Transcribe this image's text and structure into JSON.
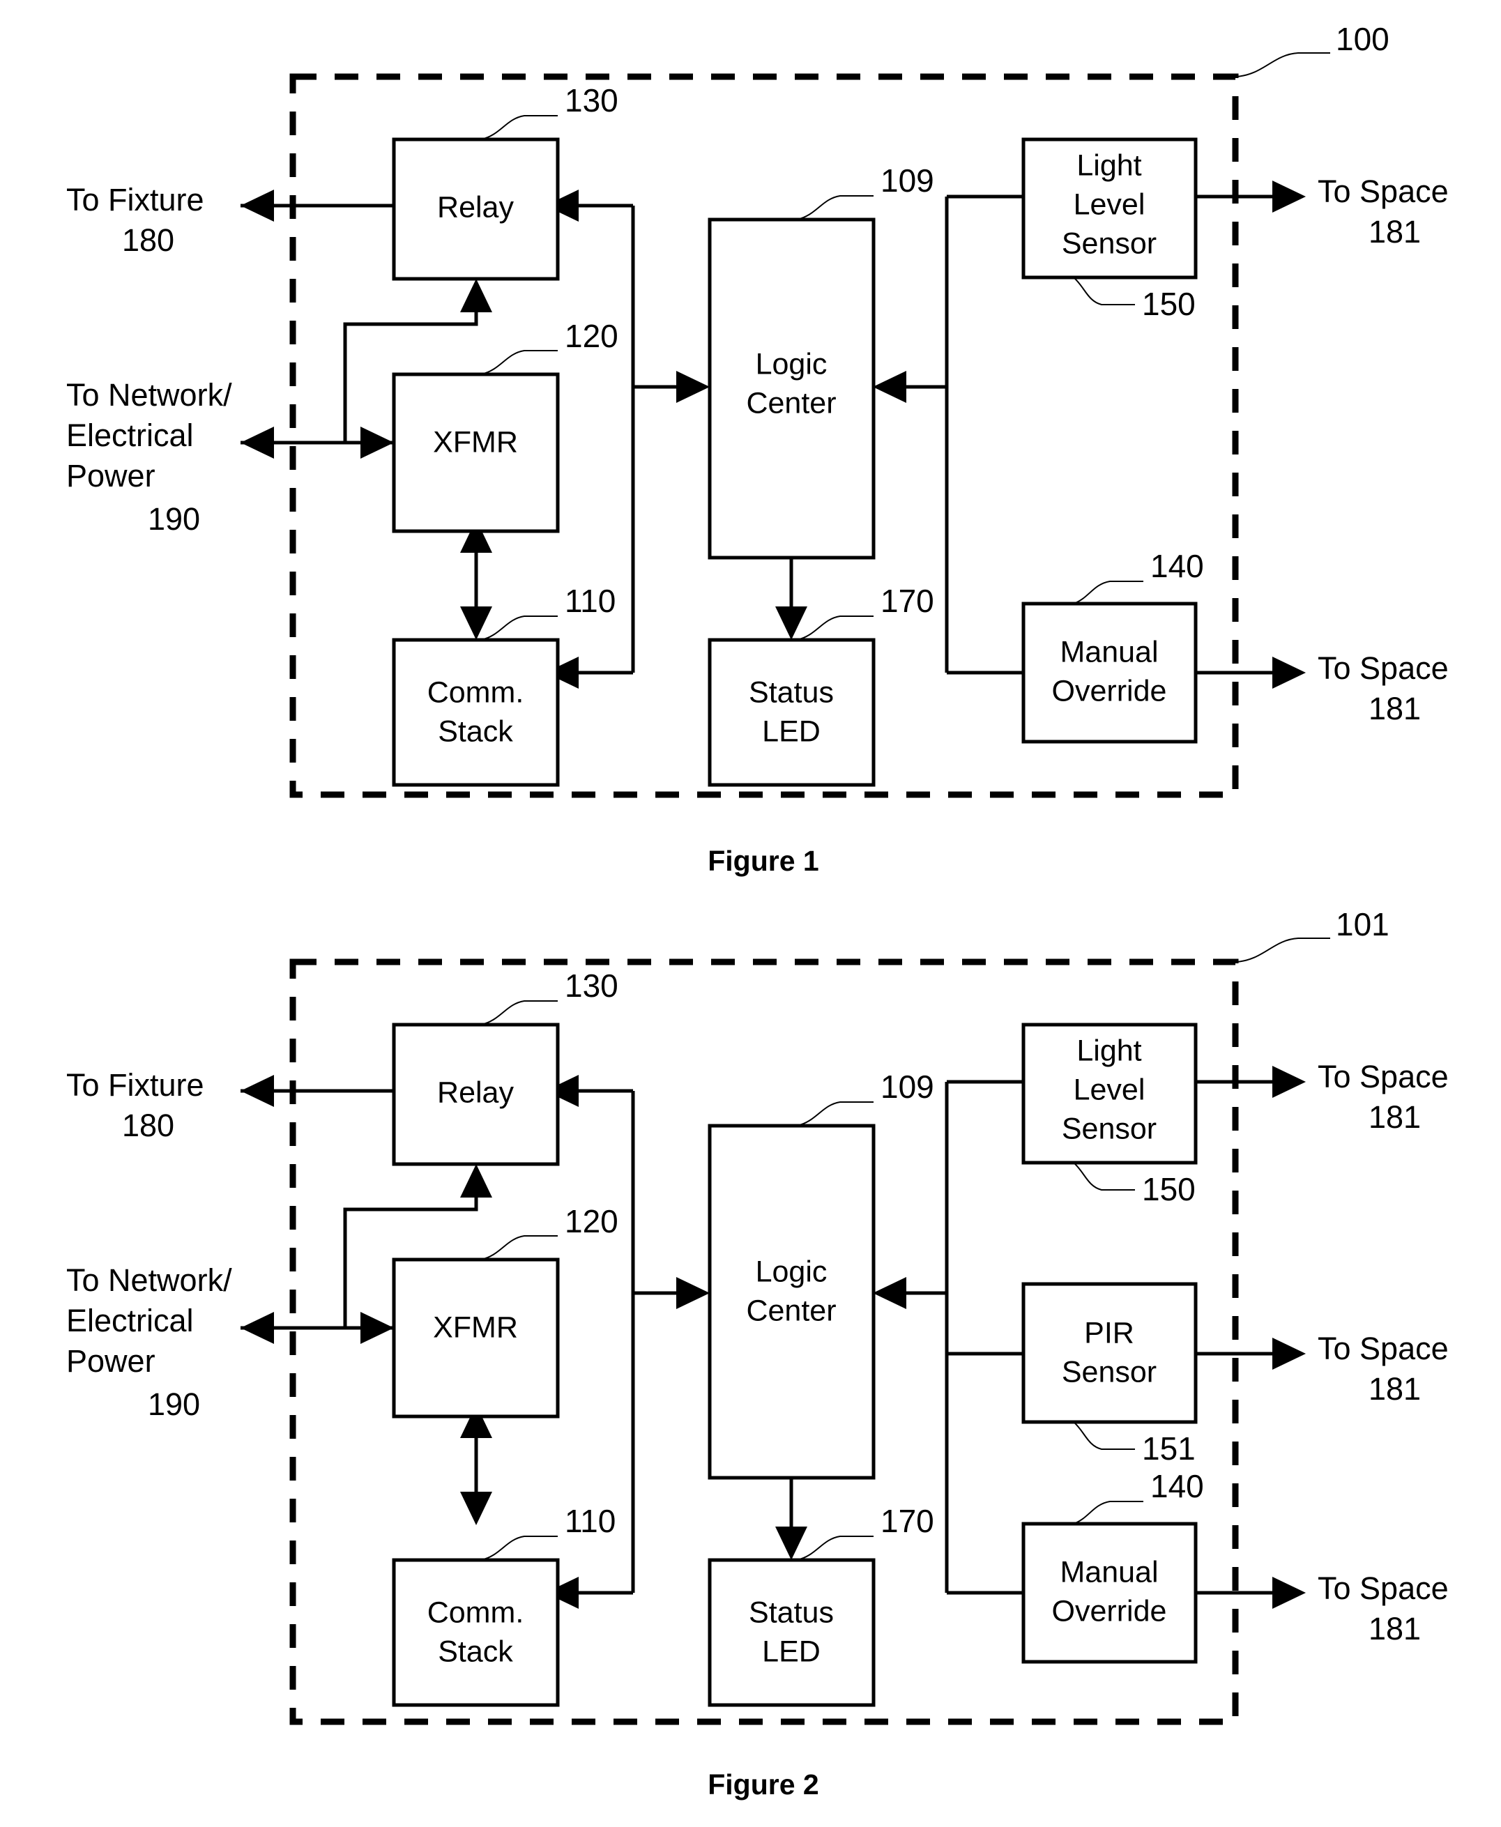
{
  "figures": [
    {
      "id": "figure-1",
      "caption": "Figure 1",
      "enclosure_ref": "100",
      "blocks": {
        "relay": {
          "label": "Relay",
          "ref": "130"
        },
        "xfmr": {
          "label": "XFMR",
          "ref": "120"
        },
        "comm_stack": {
          "line1": "Comm.",
          "line2": "Stack",
          "ref": "110"
        },
        "logic": {
          "line1": "Logic",
          "line2": "Center",
          "ref": "109"
        },
        "status_led": {
          "line1": "Status",
          "line2": "LED",
          "ref": "170"
        },
        "light_sensor": {
          "line1": "Light",
          "line2": "Level",
          "line3": "Sensor",
          "ref": "150"
        },
        "manual_override": {
          "line1": "Manual",
          "line2": "Override",
          "ref": "140"
        }
      },
      "ports": {
        "fixture": {
          "line1": "To Fixture",
          "line2": "180"
        },
        "power": {
          "line1": "To Network/",
          "line2": "Electrical",
          "line3": "Power",
          "line4": "190"
        },
        "space_top": {
          "line1": "To Space",
          "line2": "181"
        },
        "space_bottom": {
          "line1": "To Space",
          "line2": "181"
        }
      }
    },
    {
      "id": "figure-2",
      "caption": "Figure 2",
      "enclosure_ref": "101",
      "blocks": {
        "relay": {
          "label": "Relay",
          "ref": "130"
        },
        "xfmr": {
          "label": "XFMR",
          "ref": "120"
        },
        "comm_stack": {
          "line1": "Comm.",
          "line2": "Stack",
          "ref": "110"
        },
        "logic": {
          "line1": "Logic",
          "line2": "Center",
          "ref": "109"
        },
        "status_led": {
          "line1": "Status",
          "line2": "LED",
          "ref": "170"
        },
        "light_sensor": {
          "line1": "Light",
          "line2": "Level",
          "line3": "Sensor",
          "ref": "150"
        },
        "pir_sensor": {
          "line1": "PIR",
          "line2": "Sensor",
          "ref": "151"
        },
        "manual_override": {
          "line1": "Manual",
          "line2": "Override",
          "ref": "140"
        }
      },
      "ports": {
        "fixture": {
          "line1": "To Fixture",
          "line2": "180"
        },
        "power": {
          "line1": "To Network/",
          "line2": "Electrical",
          "line3": "Power",
          "line4": "190"
        },
        "space_top": {
          "line1": "To Space",
          "line2": "181"
        },
        "space_middle": {
          "line1": "To Space",
          "line2": "181"
        },
        "space_bottom": {
          "line1": "To Space",
          "line2": "181"
        }
      }
    }
  ],
  "colors": {
    "ink": "#000000",
    "paper": "#ffffff"
  }
}
